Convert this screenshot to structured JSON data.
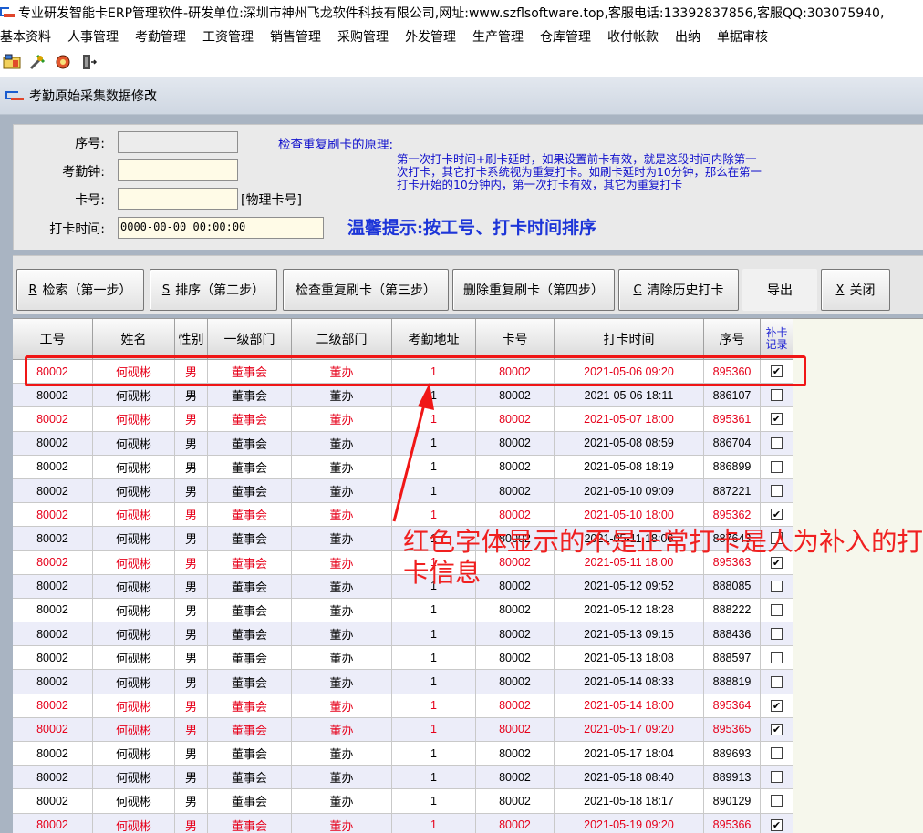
{
  "window": {
    "title": "专业研发智能卡ERP管理软件-研发单位:深圳市神州飞龙软件科技有限公司,网址:www.szflsoftware.top,客服电话:13392837856,客服QQ:303075940,"
  },
  "menubar": {
    "items": [
      "基本资料",
      "人事管理",
      "考勤管理",
      "工资管理",
      "销售管理",
      "采购管理",
      "外发管理",
      "生产管理",
      "仓库管理",
      "收付帐款",
      "出纳",
      "单据审核"
    ]
  },
  "child_window": {
    "title": "考勤原始采集数据修改"
  },
  "form": {
    "seq_label": "序号:",
    "seq_value": "",
    "clock_label": "考勤钟:",
    "clock_value": "",
    "card_label": "卡号:",
    "card_value": "",
    "card_note": "[物理卡号]",
    "time_label": "打卡时间:",
    "time_value": "0000-00-00 00:00:00",
    "hint_title": "检查重复刷卡的原理:",
    "hint_body": "第一次打卡时间+刷卡延时，如果设置前卡有效，就是这段时间内除第一次打卡，其它打卡系统视为重复打卡。如刷卡延时为10分钟，那么在第一打卡开始的10分钟内，第一次打卡有效，其它为重复打卡",
    "warm_tip": "温馨提示:按工号、打卡时间排序"
  },
  "buttons": {
    "search": {
      "hotkey": "R",
      "label": "检索（第一步）"
    },
    "sort": {
      "hotkey": "S",
      "label": "排序（第二步）"
    },
    "check_dup": {
      "label": "检查重复刷卡（第三步）"
    },
    "delete_dup": {
      "label": "删除重复刷卡（第四步）"
    },
    "clear_history": {
      "hotkey": "C",
      "label": "清除历史打卡"
    },
    "export": {
      "label": "导出"
    },
    "close": {
      "hotkey": "X",
      "label": "关闭"
    }
  },
  "table": {
    "columns": [
      "工号",
      "姓名",
      "性别",
      "一级部门",
      "二级部门",
      "考勤地址",
      "卡号",
      "打卡时间",
      "序号",
      "补卡记录"
    ],
    "rows": [
      {
        "id": "80002",
        "name": "何砚彬",
        "sex": "男",
        "dept1": "董事会",
        "dept2": "董办",
        "addr": "1",
        "card": "80002",
        "time": "2021-05-06 09:20",
        "seq": "895360",
        "supplement": true
      },
      {
        "id": "80002",
        "name": "何砚彬",
        "sex": "男",
        "dept1": "董事会",
        "dept2": "董办",
        "addr": "1",
        "card": "80002",
        "time": "2021-05-06 18:11",
        "seq": "886107",
        "supplement": false
      },
      {
        "id": "80002",
        "name": "何砚彬",
        "sex": "男",
        "dept1": "董事会",
        "dept2": "董办",
        "addr": "1",
        "card": "80002",
        "time": "2021-05-07 18:00",
        "seq": "895361",
        "supplement": true
      },
      {
        "id": "80002",
        "name": "何砚彬",
        "sex": "男",
        "dept1": "董事会",
        "dept2": "董办",
        "addr": "1",
        "card": "80002",
        "time": "2021-05-08 08:59",
        "seq": "886704",
        "supplement": false
      },
      {
        "id": "80002",
        "name": "何砚彬",
        "sex": "男",
        "dept1": "董事会",
        "dept2": "董办",
        "addr": "1",
        "card": "80002",
        "time": "2021-05-08 18:19",
        "seq": "886899",
        "supplement": false
      },
      {
        "id": "80002",
        "name": "何砚彬",
        "sex": "男",
        "dept1": "董事会",
        "dept2": "董办",
        "addr": "1",
        "card": "80002",
        "time": "2021-05-10 09:09",
        "seq": "887221",
        "supplement": false
      },
      {
        "id": "80002",
        "name": "何砚彬",
        "sex": "男",
        "dept1": "董事会",
        "dept2": "董办",
        "addr": "1",
        "card": "80002",
        "time": "2021-05-10 18:00",
        "seq": "895362",
        "supplement": true
      },
      {
        "id": "80002",
        "name": "何砚彬",
        "sex": "男",
        "dept1": "董事会",
        "dept2": "董办",
        "addr": "1",
        "card": "80002",
        "time": "2021-05-11 18:06",
        "seq": "887643",
        "supplement": false
      },
      {
        "id": "80002",
        "name": "何砚彬",
        "sex": "男",
        "dept1": "董事会",
        "dept2": "董办",
        "addr": "1",
        "card": "80002",
        "time": "2021-05-11 18:00",
        "seq": "895363",
        "supplement": true
      },
      {
        "id": "80002",
        "name": "何砚彬",
        "sex": "男",
        "dept1": "董事会",
        "dept2": "董办",
        "addr": "1",
        "card": "80002",
        "time": "2021-05-12 09:52",
        "seq": "888085",
        "supplement": false
      },
      {
        "id": "80002",
        "name": "何砚彬",
        "sex": "男",
        "dept1": "董事会",
        "dept2": "董办",
        "addr": "1",
        "card": "80002",
        "time": "2021-05-12 18:28",
        "seq": "888222",
        "supplement": false
      },
      {
        "id": "80002",
        "name": "何砚彬",
        "sex": "男",
        "dept1": "董事会",
        "dept2": "董办",
        "addr": "1",
        "card": "80002",
        "time": "2021-05-13 09:15",
        "seq": "888436",
        "supplement": false
      },
      {
        "id": "80002",
        "name": "何砚彬",
        "sex": "男",
        "dept1": "董事会",
        "dept2": "董办",
        "addr": "1",
        "card": "80002",
        "time": "2021-05-13 18:08",
        "seq": "888597",
        "supplement": false
      },
      {
        "id": "80002",
        "name": "何砚彬",
        "sex": "男",
        "dept1": "董事会",
        "dept2": "董办",
        "addr": "1",
        "card": "80002",
        "time": "2021-05-14 08:33",
        "seq": "888819",
        "supplement": false
      },
      {
        "id": "80002",
        "name": "何砚彬",
        "sex": "男",
        "dept1": "董事会",
        "dept2": "董办",
        "addr": "1",
        "card": "80002",
        "time": "2021-05-14 18:00",
        "seq": "895364",
        "supplement": true
      },
      {
        "id": "80002",
        "name": "何砚彬",
        "sex": "男",
        "dept1": "董事会",
        "dept2": "董办",
        "addr": "1",
        "card": "80002",
        "time": "2021-05-17 09:20",
        "seq": "895365",
        "supplement": true
      },
      {
        "id": "80002",
        "name": "何砚彬",
        "sex": "男",
        "dept1": "董事会",
        "dept2": "董办",
        "addr": "1",
        "card": "80002",
        "time": "2021-05-17 18:04",
        "seq": "889693",
        "supplement": false
      },
      {
        "id": "80002",
        "name": "何砚彬",
        "sex": "男",
        "dept1": "董事会",
        "dept2": "董办",
        "addr": "1",
        "card": "80002",
        "time": "2021-05-18 08:40",
        "seq": "889913",
        "supplement": false
      },
      {
        "id": "80002",
        "name": "何砚彬",
        "sex": "男",
        "dept1": "董事会",
        "dept2": "董办",
        "addr": "1",
        "card": "80002",
        "time": "2021-05-18 18:17",
        "seq": "890129",
        "supplement": false
      },
      {
        "id": "80002",
        "name": "何砚彬",
        "sex": "男",
        "dept1": "董事会",
        "dept2": "董办",
        "addr": "1",
        "card": "80002",
        "time": "2021-05-19 09:20",
        "seq": "895366",
        "supplement": true
      }
    ]
  },
  "annotation": {
    "text": "红色字体显示的不是正常打卡是人为补入的打卡信息"
  },
  "colors": {
    "supplement_text": "#e6001a",
    "annotation": "#f01616",
    "hint_text": "#1010cc"
  }
}
